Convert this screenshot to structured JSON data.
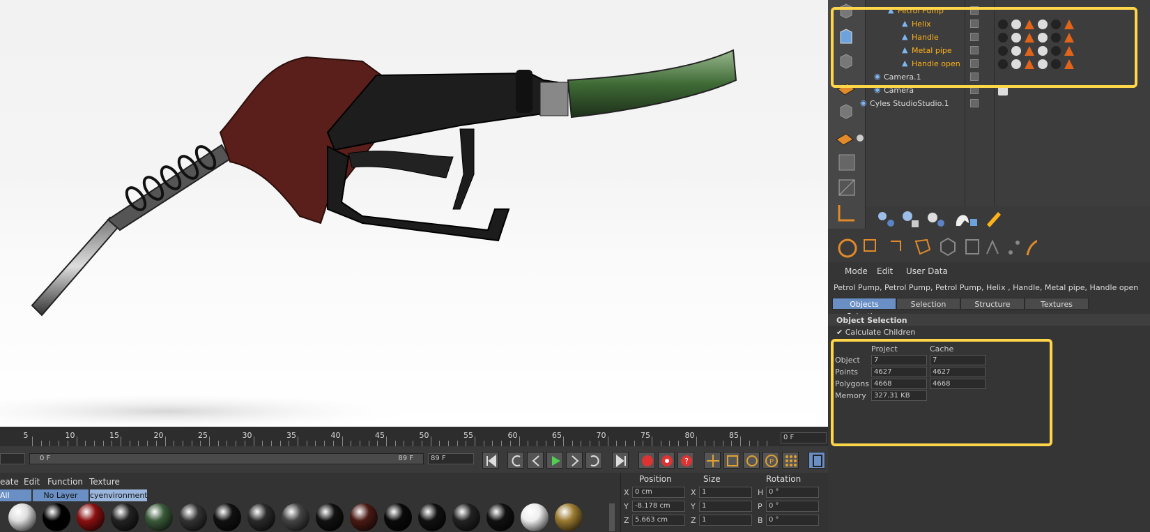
{
  "objects": [
    {
      "name": "Petrol Pump",
      "color": "#ffb21a"
    },
    {
      "name": "Helix",
      "color": "#ffb21a"
    },
    {
      "name": "Handle",
      "color": "#ffb21a"
    },
    {
      "name": "Metal  pipe",
      "color": "#ffb21a"
    },
    {
      "name": "Handle open",
      "color": "#ffb21a"
    },
    {
      "name": "Camera.1",
      "color": "#dddddd"
    },
    {
      "name": "Camera",
      "color": "#dddddd"
    },
    {
      "name": "Cyles StudioStudio.1",
      "color": "#dddddd"
    }
  ],
  "attr": {
    "menu": [
      "Mode",
      "Edit",
      "User Data"
    ],
    "selection_line": "Petrol Pump, Petrol Pump, Petrol Pump, Helix , Handle, Metal  pipe, Handle open",
    "tabs": [
      "Objects Selection",
      "Selection",
      "Structure",
      "Textures"
    ],
    "section_title": "Object Selection",
    "calc_children": "Calculate Children",
    "col_project": "Project",
    "col_cache": "Cache",
    "rows": [
      {
        "label": "Object",
        "project": "7",
        "cache": "7"
      },
      {
        "label": "Points",
        "project": "4627",
        "cache": "4627"
      },
      {
        "label": "Polygons",
        "project": "4668",
        "cache": "4668"
      },
      {
        "label": "Memory",
        "project": "327.31 KB",
        "cache": ""
      }
    ]
  },
  "timeline": {
    "ticks": [
      "5",
      "10",
      "15",
      "20",
      "25",
      "30",
      "35",
      "40",
      "45",
      "50",
      "55",
      "60",
      "65",
      "70",
      "75",
      "80",
      "85"
    ],
    "current_frame": "0 F",
    "range_start": "0 F",
    "range_end": "89 F",
    "end_frame": "89 F"
  },
  "materials": {
    "menu": [
      "eate",
      "Edit",
      "Function",
      "Texture"
    ],
    "filters": [
      "All",
      "No Layer",
      "cyenvironment"
    ]
  },
  "coords": {
    "headers": [
      "Position",
      "Size",
      "Rotation"
    ],
    "rows": [
      {
        "axis": "X",
        "pos": "0 cm",
        "size_axis": "X",
        "size": "1",
        "rot_axis": "H",
        "rot": "0 °"
      },
      {
        "axis": "Y",
        "pos": "-8.178 cm",
        "size_axis": "Y",
        "size": "1",
        "rot_axis": "P",
        "rot": "0 °"
      },
      {
        "axis": "Z",
        "pos": "5.663 cm",
        "size_axis": "Z",
        "size": "1",
        "rot_axis": "B",
        "rot": "0 °"
      }
    ]
  },
  "colors": {
    "highlight": "#ffd54a",
    "accent": "#ffb21a",
    "tab_active": "#6a8fc4"
  }
}
